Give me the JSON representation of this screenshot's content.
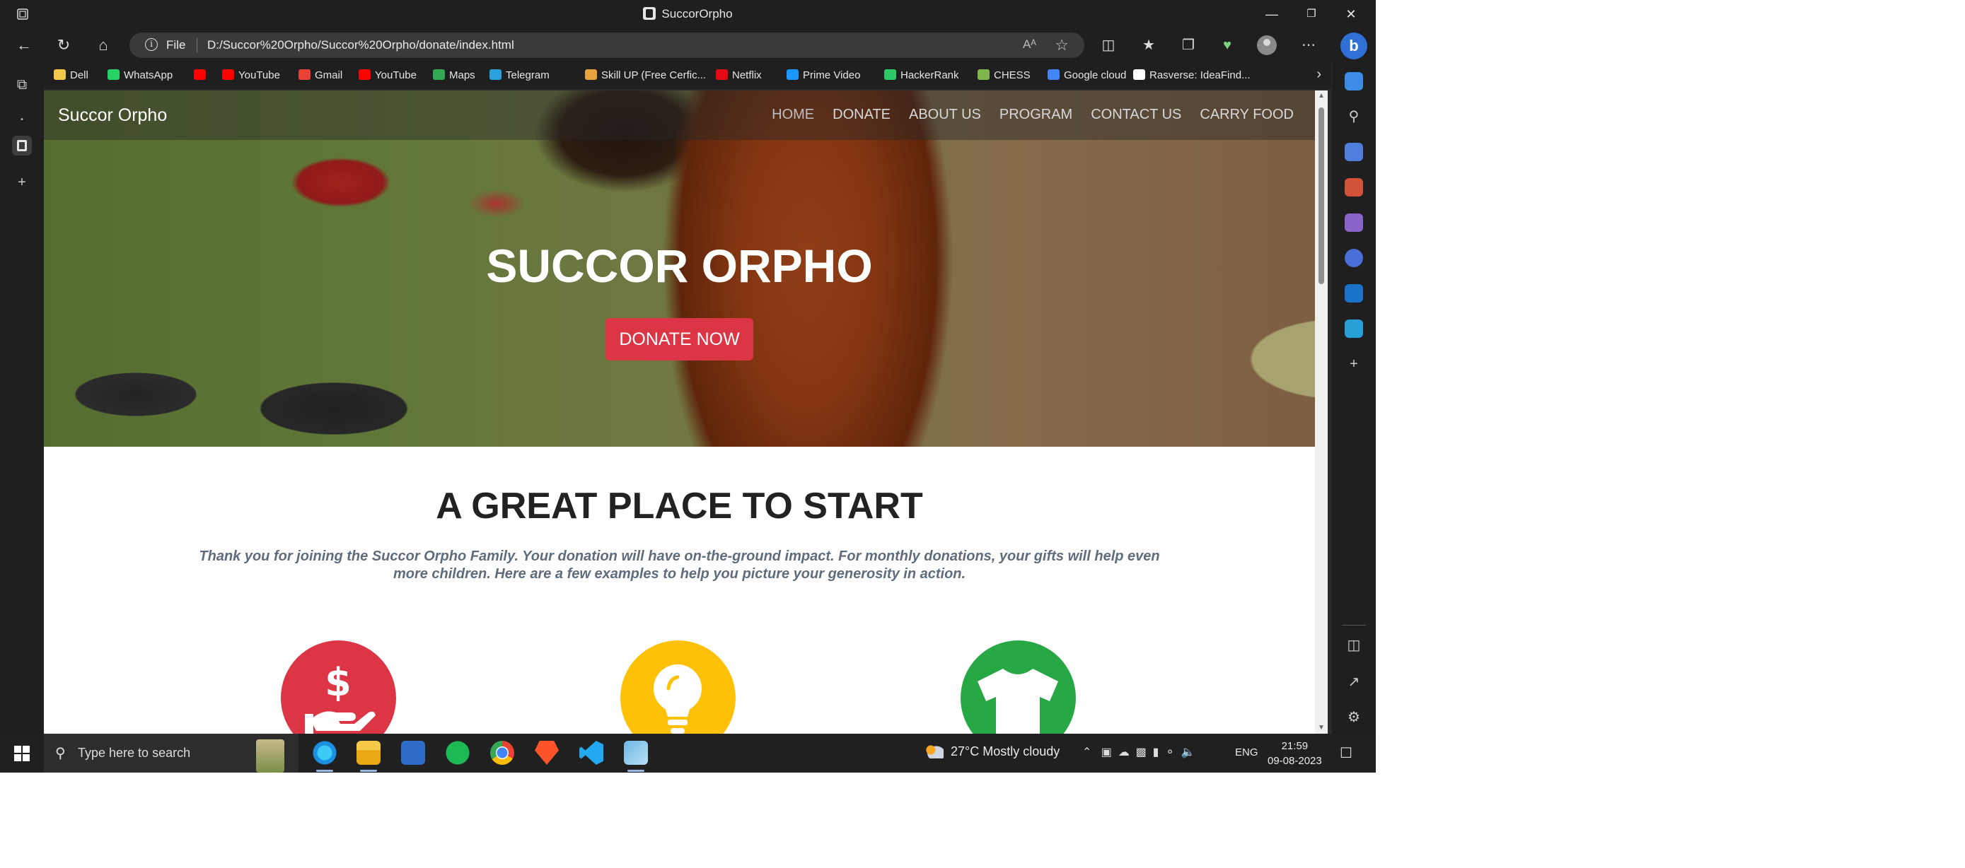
{
  "window": {
    "title": "SuccorOrpho"
  },
  "address_bar": {
    "scheme_label": "File",
    "url": "D:/Succor%20Orpho/Succor%20Orpho/donate/index.html",
    "read_aloud": "Aᴬ"
  },
  "bookmarks": [
    {
      "label": "Dell",
      "icon": "folder-icon",
      "color": "#f2c94c"
    },
    {
      "label": "WhatsApp",
      "icon": "whatsapp-icon",
      "color": "#25d366"
    },
    {
      "label": "",
      "icon": "youtube-icon",
      "color": "#ff0000"
    },
    {
      "label": "YouTube",
      "icon": "youtube-icon",
      "color": "#ff0000"
    },
    {
      "label": "Gmail",
      "icon": "gmail-icon",
      "color": "#ea4335"
    },
    {
      "label": "YouTube",
      "icon": "youtube-icon",
      "color": "#ff0000"
    },
    {
      "label": "Maps",
      "icon": "maps-icon",
      "color": "#34a853"
    },
    {
      "label": "Telegram",
      "icon": "telegram-icon",
      "color": "#2aa1da"
    },
    {
      "label": "Skill UP (Free Cerfic...",
      "icon": "skillup-icon",
      "color": "#e6a23c"
    },
    {
      "label": "Netflix",
      "icon": "netflix-icon",
      "color": "#e50914"
    },
    {
      "label": "Prime Video",
      "icon": "prime-video-icon",
      "color": "#1a98ff"
    },
    {
      "label": "HackerRank",
      "icon": "hackerrank-icon",
      "color": "#2ec866"
    },
    {
      "label": "CHESS",
      "icon": "chess-icon",
      "color": "#81b64c"
    },
    {
      "label": "Google cloud",
      "icon": "google-icon",
      "color": "#4285f4"
    },
    {
      "label": "Rasverse: IdeaFind...",
      "icon": "rasverse-icon",
      "color": "#ffffff"
    }
  ],
  "site": {
    "brand": "Succor Orpho",
    "menu": [
      "HOME",
      "DONATE",
      "ABOUT US",
      "PROGRAM",
      "CONTACT US",
      "CARRY FOOD"
    ],
    "hero_title": "SUCCOR ORPHO",
    "donate_button": "DONATE NOW",
    "section_title": "A GREAT PLACE TO START",
    "section_text": "Thank you for joining the Succor Orpho Family. Your donation will have on-the-ground impact. For monthly donations, your gifts will help even more children. Here are a few examples to help you picture your generosity in action.",
    "feature_icons": [
      {
        "icon": "hand-dollar-icon",
        "color": "#dc3545"
      },
      {
        "icon": "lightbulb-icon",
        "color": "#ffc107"
      },
      {
        "icon": "tshirt-icon",
        "color": "#28a745"
      }
    ]
  },
  "taskbar": {
    "search_placeholder": "Type here to search",
    "weather": "27°C  Mostly cloudy",
    "language": "ENG",
    "time": "21:59",
    "date": "09-08-2023"
  }
}
